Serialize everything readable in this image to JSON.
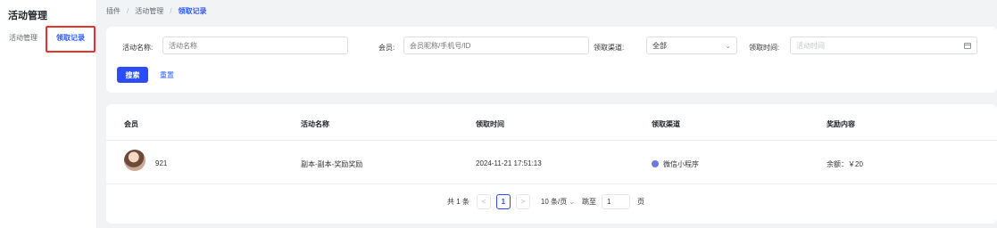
{
  "sidebar": {
    "title": "活动管理",
    "items": [
      {
        "label": "活动管理"
      },
      {
        "label": "领取记录"
      }
    ]
  },
  "breadcrumb": [
    "插件",
    "活动管理",
    "领取记录"
  ],
  "breadcrumb_sep": "/",
  "filters": {
    "activity_name": {
      "label": "活动名称:",
      "placeholder": "活动名称",
      "value": ""
    },
    "member": {
      "label": "会员:",
      "placeholder": "会员昵称/手机号/ID",
      "value": ""
    },
    "channel": {
      "label": "领取渠道:",
      "value": "全部"
    },
    "time": {
      "label": "领取时间:",
      "placeholder": "活动时间",
      "value": ""
    }
  },
  "actions": {
    "search_label": "搜索",
    "reset_label": "重置"
  },
  "table": {
    "columns": [
      "会员",
      "活动名称",
      "领取时间",
      "领取渠道",
      "奖励内容"
    ],
    "rows": [
      {
        "member": "921",
        "activity": "副本-副本-奖励奖励",
        "time": "2024-11-21 17:51:13",
        "channel": "微信小程序",
        "reward": "余额：￥20"
      }
    ]
  },
  "pagination": {
    "total_text": "共 1 条",
    "prev": "<",
    "current_page": "1",
    "next": ">",
    "page_size": "10 条/页",
    "jump_label": "跳至",
    "jump_value": "1",
    "page_suffix": "页"
  },
  "colors": {
    "primary": "#2d4cf5",
    "highlight_box": "#e5332a",
    "channel_icon": "#6c7ae0"
  },
  "icons": {
    "chevron": "chevron-down-icon",
    "calendar": "calendar-icon",
    "avatar": "member-avatar",
    "channel": "wechat-miniprogram-icon"
  }
}
